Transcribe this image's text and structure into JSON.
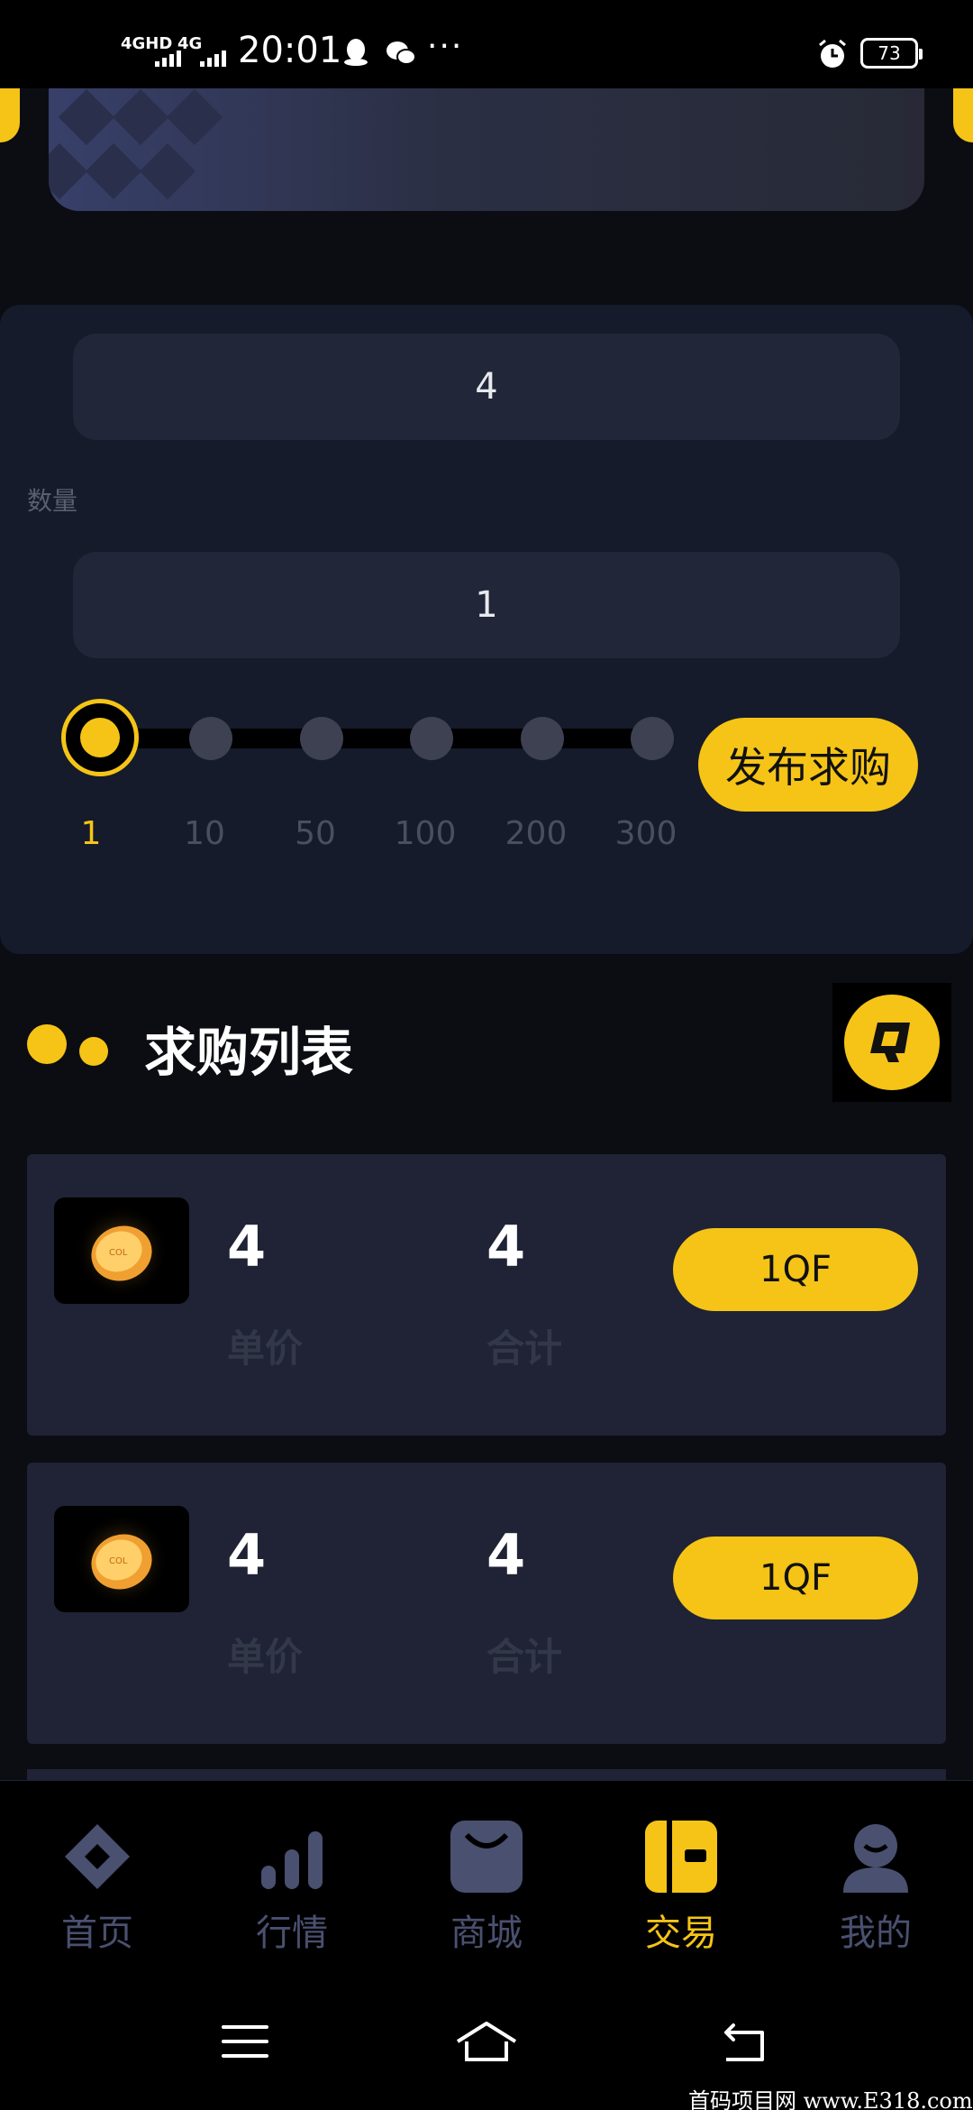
{
  "status_bar": {
    "network1": "4GHD",
    "network2": "4G",
    "time": "20:01",
    "more": "···",
    "battery": "73"
  },
  "form": {
    "price_value": "4",
    "quantity_label": "数量",
    "quantity_value": "1",
    "slider_options": [
      "1",
      "10",
      "50",
      "100",
      "200",
      "300"
    ],
    "slider_selected": "1",
    "publish_button": "发布求购"
  },
  "list": {
    "title": "求购列表",
    "items": [
      {
        "unit_price": "4",
        "unit_price_label": "单价",
        "total": "4",
        "total_label": "合计",
        "action": "1QF",
        "coin_text": "COL"
      },
      {
        "unit_price": "4",
        "unit_price_label": "单价",
        "total": "4",
        "total_label": "合计",
        "action": "1QF",
        "coin_text": "COL"
      }
    ]
  },
  "bottom_nav": {
    "items": [
      {
        "label": "首页",
        "icon": "diamond-home-icon"
      },
      {
        "label": "行情",
        "icon": "bar-chart-icon"
      },
      {
        "label": "商城",
        "icon": "shop-bag-icon"
      },
      {
        "label": "交易",
        "icon": "trade-icon",
        "active": true
      },
      {
        "label": "我的",
        "icon": "profile-icon"
      }
    ]
  },
  "watermark": "首码项目网 www.E318.com",
  "colors": {
    "accent": "#f5c416",
    "background": "#0c0d12",
    "panel": "#161b2b",
    "card": "#1f2335",
    "muted": "#4a5070"
  }
}
